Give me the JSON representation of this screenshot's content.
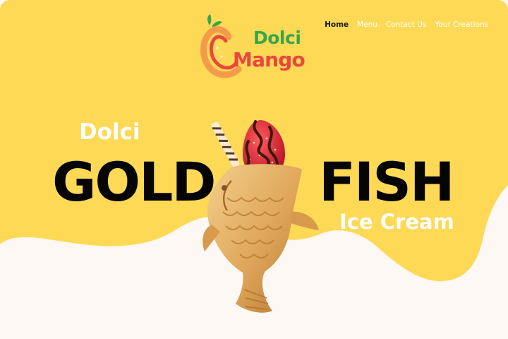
{
  "brand": {
    "logo_top": "Dolci",
    "logo_bottom": "Mango"
  },
  "nav": {
    "items": [
      {
        "label": "Home",
        "active": true
      },
      {
        "label": "Menu",
        "active": false
      },
      {
        "label": "Contact Us",
        "active": false
      },
      {
        "label": "Your Creations",
        "active": false
      }
    ]
  },
  "hero": {
    "line1": "Dolci",
    "title_left": "GOLD",
    "title_right": "FISH",
    "line3": "Ice Cream"
  },
  "colors": {
    "banner_yellow": "#fdd956",
    "page_background": "#fdf8f4",
    "logo_green": "#3aa64a",
    "logo_red": "#e9473f",
    "logo_orange": "#f59a4a"
  },
  "icons": {
    "logo_mark": "mango-icon",
    "product": "goldfish-ice-cream-cone"
  }
}
